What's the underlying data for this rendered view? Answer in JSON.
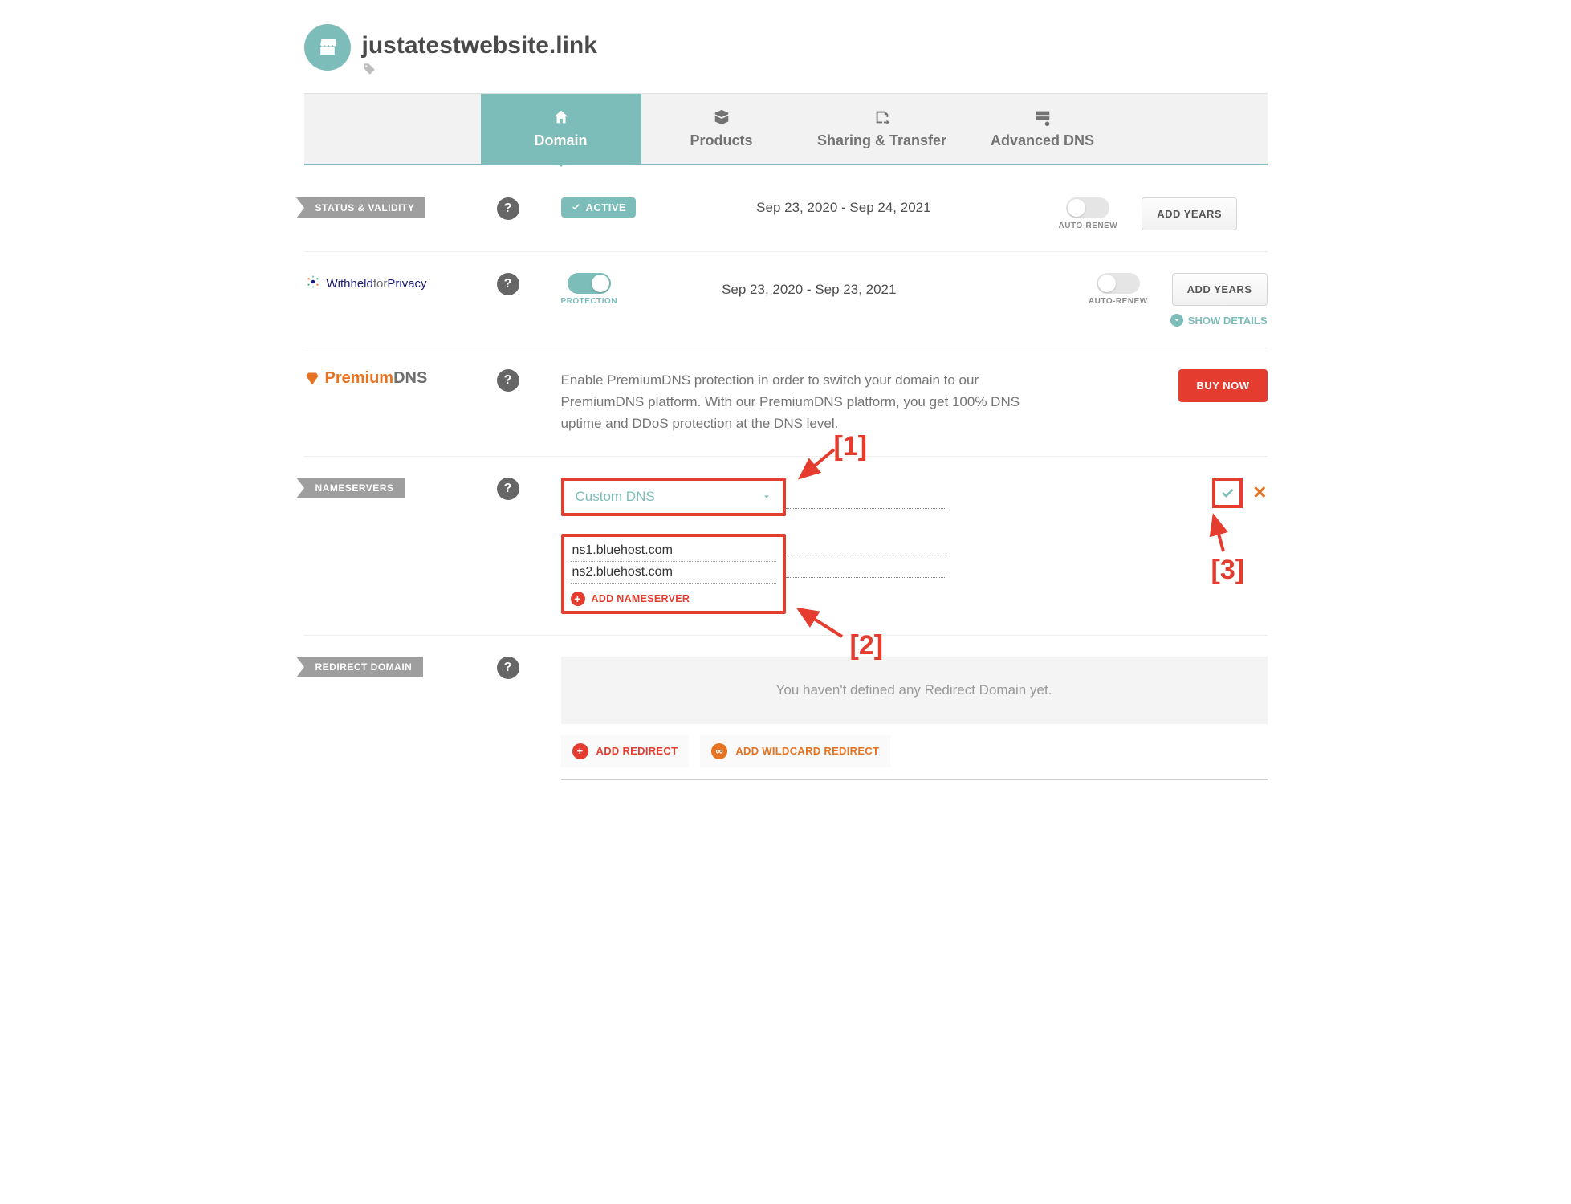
{
  "header": {
    "domain_title": "justatestwebsite.link"
  },
  "tabs": {
    "t0": "Domain",
    "t1": "Products",
    "t2": "Sharing & Transfer",
    "t3": "Advanced DNS"
  },
  "status": {
    "label": "STATUS & VALIDITY",
    "badge": "ACTIVE",
    "dates": "Sep 23, 2020 - Sep 24, 2021",
    "auto_renew": "AUTO-RENEW",
    "add_years": "ADD YEARS"
  },
  "privacy": {
    "brand_part1": "Withheld",
    "brand_part2": "for",
    "brand_part3": "Privacy",
    "protection_lbl": "PROTECTION",
    "dates": "Sep 23, 2020 - Sep 23, 2021",
    "auto_renew": "AUTO-RENEW",
    "add_years": "ADD YEARS",
    "show_details": "SHOW DETAILS"
  },
  "premiumdns": {
    "brand_p1": "Premium",
    "brand_p2": "DNS",
    "description": "Enable PremiumDNS protection in order to switch your domain to our PremiumDNS platform. With our PremiumDNS platform, you get 100% DNS uptime and DDoS protection at the DNS level.",
    "buy_now": "BUY NOW"
  },
  "nameservers": {
    "label": "NAMESERVERS",
    "dropdown_value": "Custom DNS",
    "ns1": "ns1.bluehost.com",
    "ns2": "ns2.bluehost.com",
    "add_label": "ADD NAMESERVER"
  },
  "callouts": {
    "c1": "[1]",
    "c2": "[2]",
    "c3": "[3]"
  },
  "redirect": {
    "label": "REDIRECT DOMAIN",
    "empty_msg": "You haven't defined any Redirect Domain yet.",
    "add_redirect": "ADD REDIRECT",
    "add_wildcard": "ADD WILDCARD REDIRECT"
  }
}
